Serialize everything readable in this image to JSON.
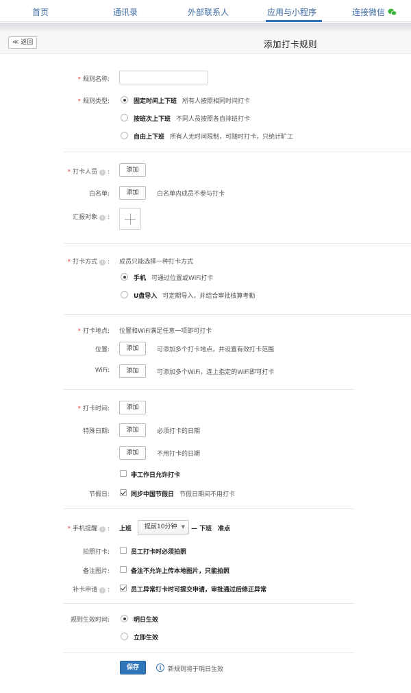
{
  "nav": {
    "tabs": [
      {
        "label": "首页"
      },
      {
        "label": "通讯录"
      },
      {
        "label": "外部联系人"
      },
      {
        "label": "应用与小程序"
      },
      {
        "label": "连接微信"
      }
    ],
    "active_tab": "应用与小程序",
    "accent_color": "#2f6fb8",
    "wechat_color": "#3bb33b"
  },
  "header": {
    "back_label": "≪ 返回",
    "title": "添加打卡规则"
  },
  "form": {
    "rule_name": {
      "label": "规则名称:",
      "value": ""
    },
    "rule_type": {
      "label": "规则类型:",
      "options": [
        {
          "name": "固定时间上下班",
          "hint": "所有人按照相同时间打卡",
          "selected": true
        },
        {
          "name": "按班次上下班",
          "hint": "不同人员按照各自排班打卡",
          "selected": false
        },
        {
          "name": "自由上下班",
          "hint": "所有人无时间限制，可随时打卡，只统计旷工",
          "selected": false
        }
      ]
    },
    "members": {
      "label": "打卡人员",
      "help_icon": "info-icon",
      "button": "添加"
    },
    "whitelist": {
      "label": "白名单:",
      "button": "添加",
      "hint": "白名单内成员不参与打卡"
    },
    "report_to": {
      "label": "汇报对象"
    },
    "method": {
      "label": "打卡方式",
      "hint": "成员只能选择一种打卡方式",
      "options": [
        {
          "name": "手机",
          "hint": "可通过位置或WiFi打卡",
          "selected": true
        },
        {
          "name": "U盘导入",
          "hint": "可定期导入，并结合审批核算考勤",
          "selected": false
        }
      ]
    },
    "location": {
      "label": "打卡地点:",
      "hint": "位置和WiFi满足任意一项即可打卡",
      "position": {
        "label": "位置:",
        "button": "添加",
        "hint": "可添加多个打卡地点，并设置有效打卡范围"
      },
      "wifi": {
        "label": "WiFi:",
        "button": "添加",
        "hint": "可添加多个WiFi，连上指定的WiFi即可打卡"
      }
    },
    "time": {
      "label": "打卡时间:",
      "button": "添加"
    },
    "special_dates": {
      "label": "特殊日期:",
      "must": {
        "button": "添加",
        "hint": "必须打卡的日期"
      },
      "no_need": {
        "button": "添加",
        "hint": "不用打卡的日期"
      },
      "non_workday": {
        "label": "非工作日允许打卡",
        "checked": false
      }
    },
    "holiday": {
      "label": "节假日:",
      "option": "同步中国节假日",
      "hint": "节假日期间不用打卡",
      "checked": true
    },
    "reminder": {
      "label": "手机提醒",
      "prefix": "上班",
      "select_value": "提前10分钟",
      "caret": "▼",
      "dash": "—",
      "off_label": "下班",
      "off_value": "准点"
    },
    "photo": {
      "label": "拍照打卡:",
      "option": "员工打卡时必须拍照",
      "checked": false
    },
    "note_image": {
      "label": "备注图片:",
      "option": "备注不允许上传本地图片，只能拍照",
      "checked": false
    },
    "resubmit": {
      "label": "补卡申请",
      "option": "员工异常打卡时可提交申请，审批通过后修正异常",
      "checked": true
    },
    "effective": {
      "label": "规则生效时间:",
      "options": [
        {
          "name": "明日生效",
          "selected": true
        },
        {
          "name": "立即生效",
          "selected": false
        }
      ]
    }
  },
  "footer": {
    "save_label": "保存",
    "info_text": "新规则将于明日生效",
    "save_color": "#2f75b9"
  }
}
